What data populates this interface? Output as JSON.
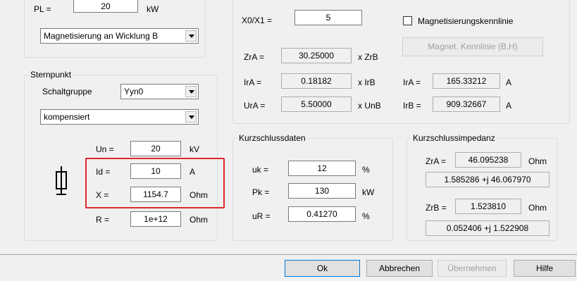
{
  "top_left": {
    "pl_label": "PL =",
    "pl_value": "20",
    "pl_unit": "kW",
    "magnetization_select": "Magnetisierung an Wicklung B"
  },
  "sternpunkt": {
    "legend": "Sternpunkt",
    "schaltgruppe_label": "Schaltgruppe",
    "schaltgruppe_value": "Yyn0",
    "mode_select": "kompensiert",
    "un_label": "Un =",
    "un_value": "20",
    "un_unit": "kV",
    "id_label": "Id =",
    "id_value": "10",
    "id_unit": "A",
    "x_label": "X =",
    "x_value": "1154.7",
    "x_unit": "Ohm",
    "r_label": "R =",
    "r_value": "1e+12",
    "r_unit": "Ohm"
  },
  "top_right": {
    "x0x1_label": "X0/X1 =",
    "x0x1_value": "5",
    "magnet_checkbox_label": "Magnetisierungskennlinie",
    "magnet_button": "Magnet. Kennlinie (B,H)",
    "zra_label": "ZrA =",
    "zra_value": "30.25000",
    "zra_unit": "x ZrB",
    "ira_label": "IrA =",
    "ira_value": "0.18182",
    "ira_unit": "x IrB",
    "ura_label": "UrA =",
    "ura_value": "5.50000",
    "ura_unit": "x UnB",
    "ira_abs_label": "IrA =",
    "ira_abs_value": "165.33212",
    "ira_abs_unit": "A",
    "irb_label": "IrB =",
    "irb_value": "909.32667",
    "irb_unit": "A"
  },
  "kurzschlussdaten": {
    "legend": "Kurzschlussdaten",
    "uk_label": "uk =",
    "uk_value": "12",
    "uk_unit": "%",
    "pk_label": "Pk =",
    "pk_value": "130",
    "pk_unit": "kW",
    "ur_label": "uR =",
    "ur_value": "0.41270",
    "ur_unit": "%"
  },
  "kurzschlussimpedanz": {
    "legend": "Kurzschlussimpedanz",
    "zra_label": "ZrA =",
    "zra_value": "46.095238",
    "zra_unit": "Ohm",
    "zra_complex": "1.585286 +j 46.067970",
    "zrb_label": "ZrB =",
    "zrb_value": "1.523810",
    "zrb_unit": "Ohm",
    "zrb_complex": "0.052406 +j 1.522908"
  },
  "buttons": {
    "ok": "Ok",
    "cancel": "Abbrechen",
    "apply": "Übernehmen",
    "help": "Hilfe"
  },
  "icons": {
    "transformer": "grounding-coil-icon"
  },
  "colors": {
    "highlight": "#e0282e",
    "background": "#f0f0f0"
  }
}
